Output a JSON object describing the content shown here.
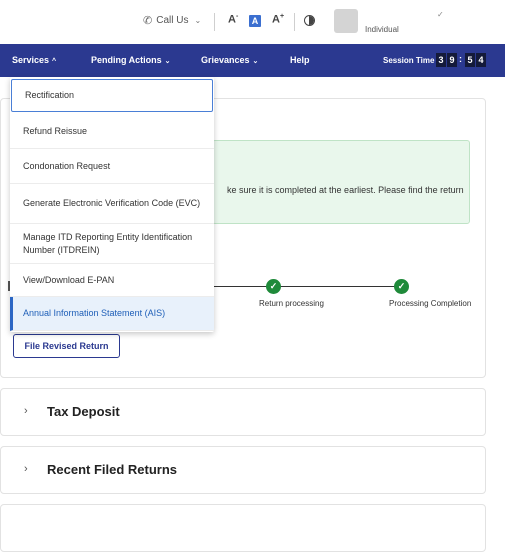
{
  "topbar": {
    "call_label": "Call Us",
    "font_decrease": "A",
    "font_default": "A",
    "font_increase": "A",
    "user_role": "Individual"
  },
  "nav": {
    "services": "Services",
    "pending_actions": "Pending Actions",
    "grievances": "Grievances",
    "help": "Help",
    "session_label": "Session Time",
    "session_digits": [
      "3",
      "9",
      "5",
      "4"
    ]
  },
  "services_menu": [
    {
      "label": "Rectification"
    },
    {
      "label": "Refund Reissue"
    },
    {
      "label": "Condonation Request"
    },
    {
      "label": "Generate Electronic Verification Code (EVC)"
    },
    {
      "label": "Manage ITD Reporting Entity Identification Number (ITDREIN)"
    },
    {
      "label": "View/Download E-PAN"
    },
    {
      "label": "Annual Information Statement (AIS)"
    }
  ],
  "main": {
    "alert_text": "ke sure it is completed at the earliest. Please find the return",
    "steps": [
      {
        "label": "Return processing"
      },
      {
        "label": "Processing Completion"
      }
    ],
    "file_revised_button": "File Revised Return"
  },
  "sections": [
    {
      "title": "Tax Deposit"
    },
    {
      "title": "Recent Filed Returns"
    }
  ],
  "colors": {
    "nav_bg": "#2b3990",
    "alert_bg": "#e9f7ec",
    "step_green": "#1f8a3a",
    "active_item_text": "#2060b8"
  }
}
